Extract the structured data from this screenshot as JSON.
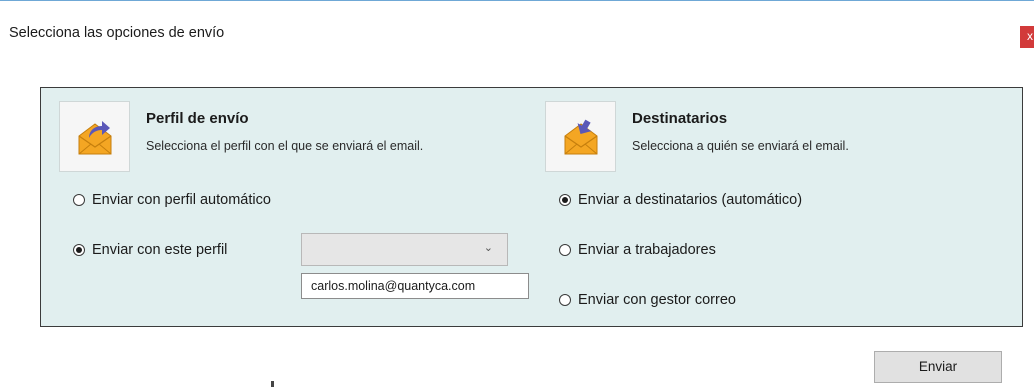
{
  "window": {
    "title": "Selecciona las opciones de envío",
    "close_label": "x"
  },
  "profile": {
    "title": "Perfil de envío",
    "description": "Selecciona el perfil con el que se enviará el email.",
    "icon": "email-send-icon",
    "options": [
      {
        "label": "Enviar con perfil automático",
        "checked": false
      },
      {
        "label": "Enviar con este perfil",
        "checked": true
      }
    ],
    "select_value": "",
    "dropdown_option": "carlos.molina@quantyca.com"
  },
  "recipients": {
    "title": "Destinatarios",
    "description": "Selecciona a quién se enviará el email.",
    "icon": "email-receive-icon",
    "options": [
      {
        "label": "Enviar a destinatarios (automático)",
        "checked": true
      },
      {
        "label": "Enviar a trabajadores",
        "checked": false
      },
      {
        "label": "Enviar con gestor correo",
        "checked": false
      }
    ]
  },
  "actions": {
    "send_label": "Enviar"
  },
  "colors": {
    "panel_bg": "#e1efef",
    "close_bg": "#d23a3a",
    "envelope": "#f4a623",
    "arrow": "#5b58b8"
  }
}
